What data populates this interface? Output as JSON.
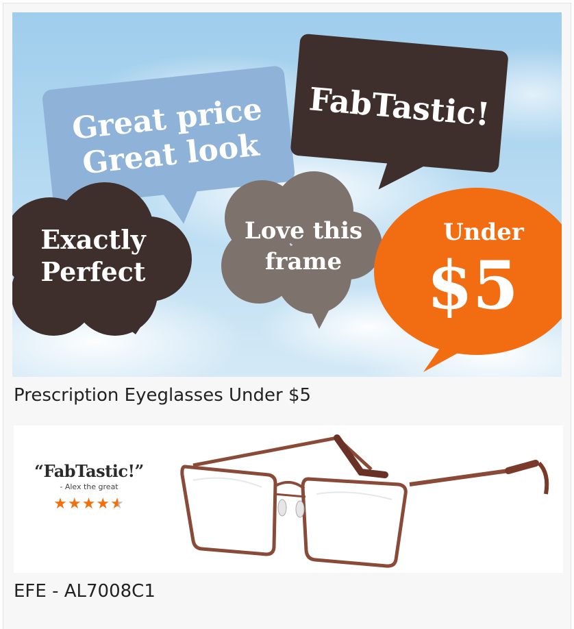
{
  "banner": {
    "bubbles": {
      "great_line1": "Great price",
      "great_line2": "Great look",
      "fab": "FabTastic!",
      "exactly_line1": "Exactly",
      "exactly_line2": "Perfect",
      "love_line1": "Love this",
      "love_line2": "frame",
      "under": "Under",
      "price": "$5"
    }
  },
  "captions": {
    "promo": "Prescription Eyeglasses Under $5",
    "product": "EFE - AL7008C1"
  },
  "review": {
    "quote": "“FabTastic!”",
    "reviewer": "- Alex the great",
    "rating": 4.5,
    "stars_full": [
      "★",
      "★",
      "★",
      "★"
    ],
    "star_partial": "★"
  },
  "colors": {
    "sky": "#b7d9f0",
    "bubble_blue": "#8fb3d8",
    "bubble_dark": "#3e2f2c",
    "bubble_grey": "#7e726c",
    "bubble_orange": "#f26d12",
    "frame_brown": "#8a4a38",
    "star_orange": "#f0700d"
  }
}
